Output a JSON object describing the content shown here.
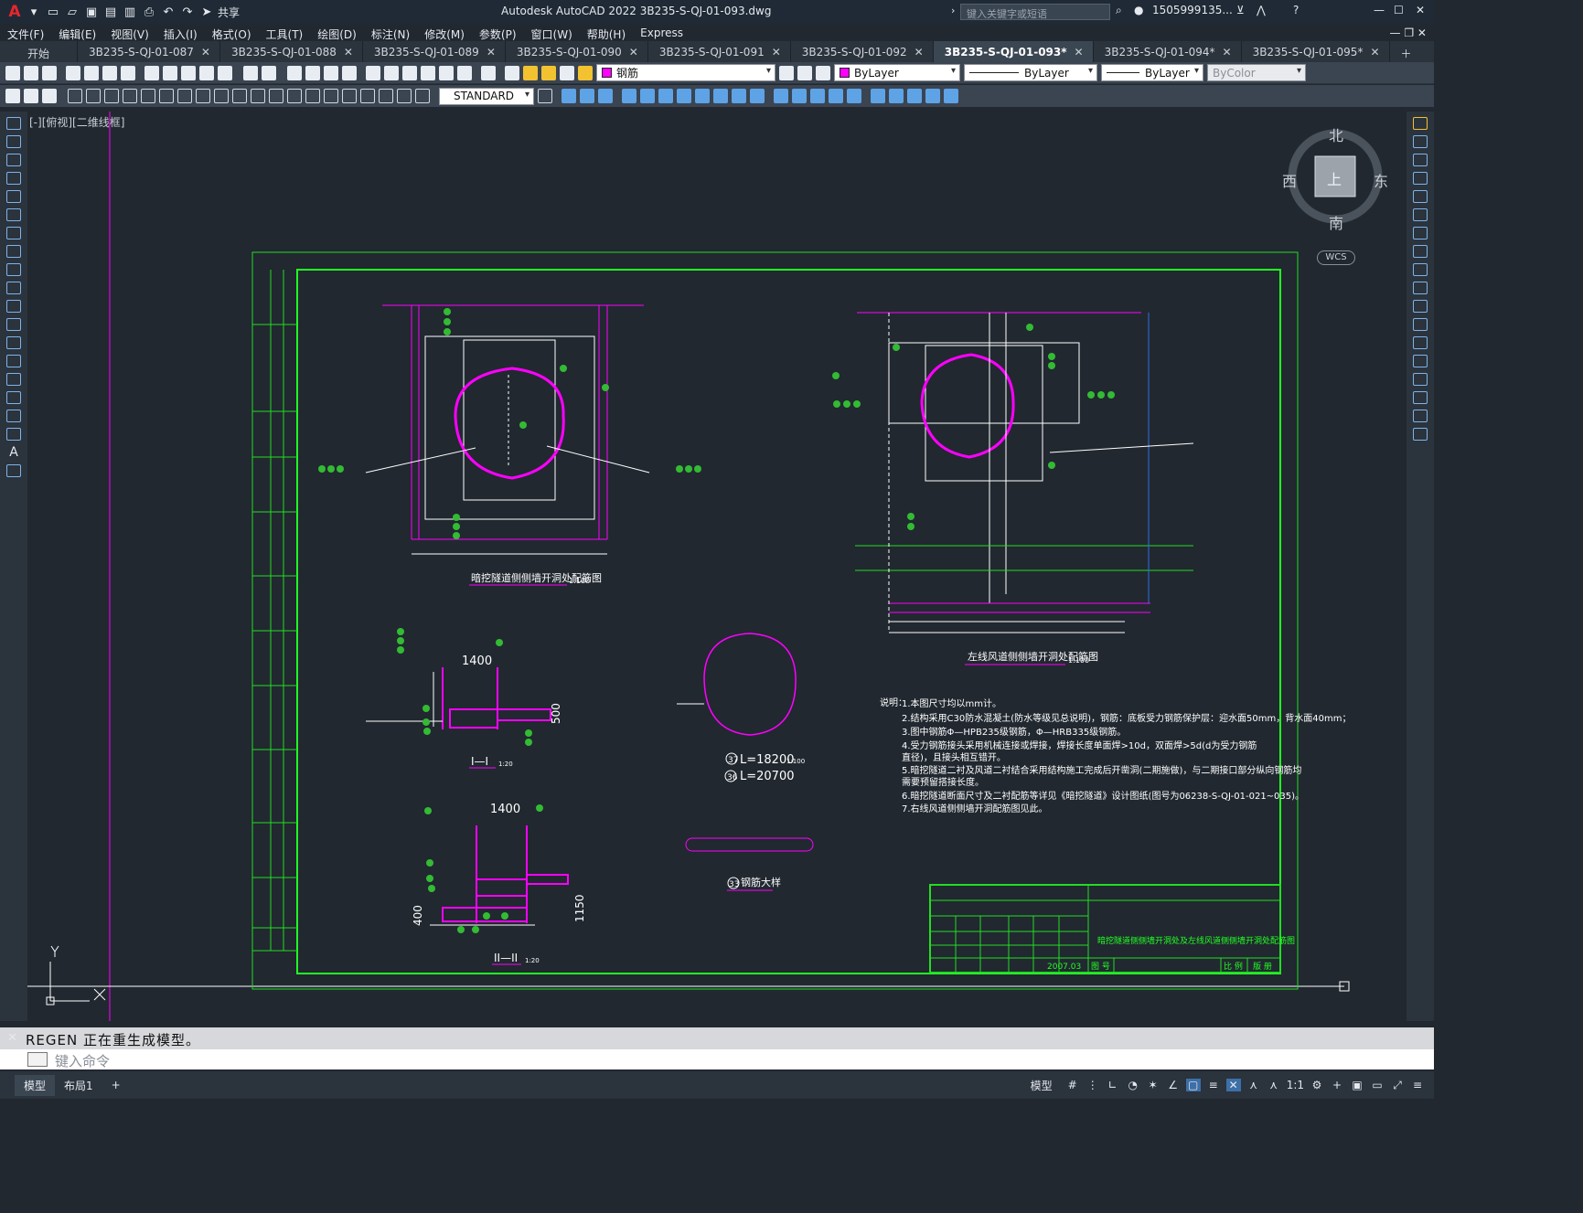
{
  "app": {
    "title": "Autodesk AutoCAD 2022    3B235-S-QJ-01-093.dwg",
    "search_placeholder": "键入关键字或短语",
    "user": "1505999135...",
    "share_label": "共享"
  },
  "menu": [
    "文件(F)",
    "编辑(E)",
    "视图(V)",
    "插入(I)",
    "格式(O)",
    "工具(T)",
    "绘图(D)",
    "标注(N)",
    "修改(M)",
    "参数(P)",
    "窗口(W)",
    "帮助(H)",
    "Express"
  ],
  "tabs": [
    {
      "label": "开始",
      "active": false
    },
    {
      "label": "3B235-S-QJ-01-087",
      "active": false
    },
    {
      "label": "3B235-S-QJ-01-088",
      "active": false
    },
    {
      "label": "3B235-S-QJ-01-089",
      "active": false
    },
    {
      "label": "3B235-S-QJ-01-090",
      "active": false
    },
    {
      "label": "3B235-S-QJ-01-091",
      "active": false
    },
    {
      "label": "3B235-S-QJ-01-092",
      "active": false
    },
    {
      "label": "3B235-S-QJ-01-093*",
      "active": true
    },
    {
      "label": "3B235-S-QJ-01-094*",
      "active": false
    },
    {
      "label": "3B235-S-QJ-01-095*",
      "active": false
    }
  ],
  "toolbar": {
    "layer": "钢筋",
    "color": "ByLayer",
    "linetype": "ByLayer",
    "lineweight": "ByLayer",
    "plotstyle": "ByColor",
    "textstyle": "STANDARD"
  },
  "viewport": {
    "label": "[-][俯视][二维线框]",
    "compass": {
      "n": "北",
      "s": "南",
      "e": "东",
      "w": "西",
      "top": "上"
    },
    "wcs": "WCS"
  },
  "drawing": {
    "title1": "暗挖隧道侧侧墙开洞处配筋图",
    "title1_scale": "1:100",
    "title2": "左线风道侧侧墙开洞处配筋图",
    "title2_scale": "1:100",
    "sec1": "I—I",
    "sec1_scale": "1:20",
    "sec2": "II—II",
    "sec2_scale": "1:20",
    "dim1400a": "1400",
    "dim1400b": "1400",
    "dim500": "500",
    "dim400": "400",
    "dim1150": "1150",
    "l37": "L=18200",
    "l37_scale": "1:100",
    "l36": "L=20700",
    "n37": "37",
    "n36": "36",
    "n33": "33",
    "rebar33": "钢筋大样",
    "notes_head": "说明：",
    "notes": [
      "1.本图尺寸均以mm计。",
      "2.结构采用C30防水混凝土(防水等级见总说明)，钢筋：底板受力钢筋保护层：迎水面50mm，背水面40mm；",
      "3.图中钢筋Φ—HPB235级钢筋，Φ—HRB335级钢筋。",
      "4.受力钢筋接头采用机械连接或焊接，焊接长度单面焊>10d，双面焊>5d(d为受力钢筋",
      "  直径)，且接头相互错开。",
      "5.暗挖隧道二衬及风道二衬结合采用结构施工完成后开凿洞(二期施做)，与二期接口部分纵向钢筋均",
      "  需要预留搭接长度。",
      "6.暗挖隧道断面尺寸及二衬配筋等详见《暗挖隧道》设计图纸(图号为06238-S-QJ-01-021~035)。",
      "7.右线风道侧侧墙开洞配筋图见此。"
    ],
    "tb_title": "暗挖隧道侧侧墙开洞处及左线风道侧侧墙开洞处配筋图",
    "tb_date": "2007.03",
    "tb_tuhao": "图 号",
    "tb_bili": "比 例",
    "tb_yeci": "版 册"
  },
  "command": {
    "history": "REGEN  正在重生成模型。",
    "placeholder": "键入命令"
  },
  "status": {
    "model": "模型",
    "layout1": "布局1",
    "model_btn": "模型",
    "scale": "1:1"
  }
}
